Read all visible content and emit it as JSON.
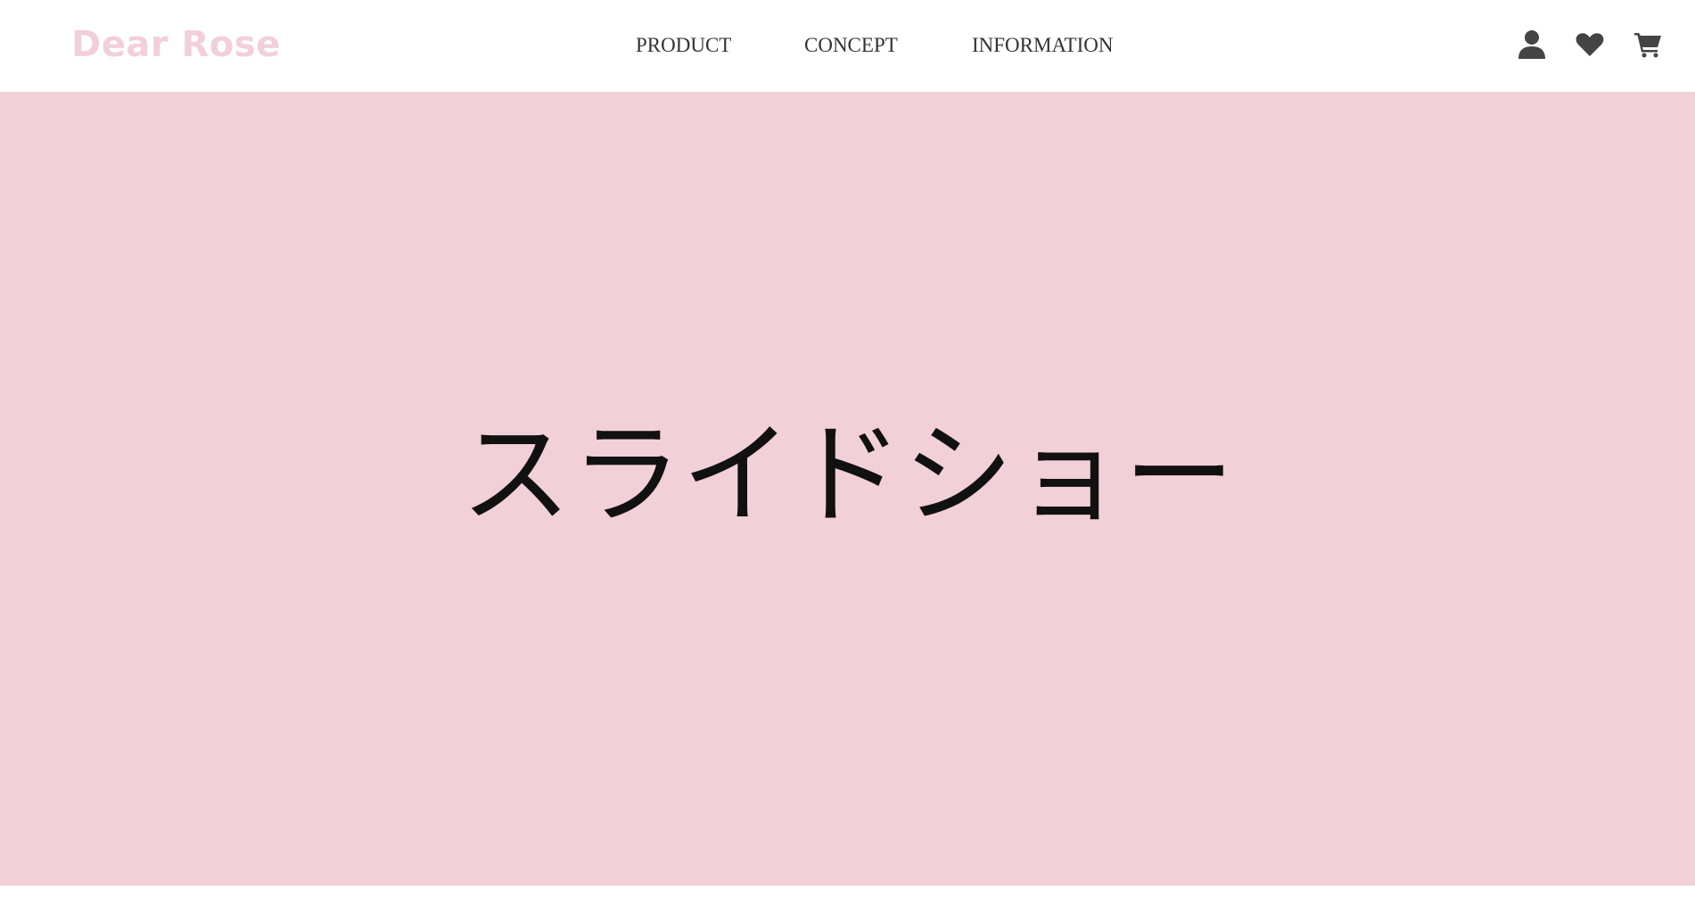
{
  "header": {
    "logo_text": "Dear Rose",
    "nav": [
      {
        "label": "PRODUCT"
      },
      {
        "label": "CONCEPT"
      },
      {
        "label": "INFORMATION"
      }
    ],
    "icons": [
      "user-icon",
      "heart-icon",
      "cart-icon"
    ]
  },
  "hero": {
    "title": "スライドショー",
    "background_color": "#f2d0d7"
  },
  "colors": {
    "logo": "#f2d0d9",
    "nav_text": "#333333",
    "icon": "#444444"
  }
}
